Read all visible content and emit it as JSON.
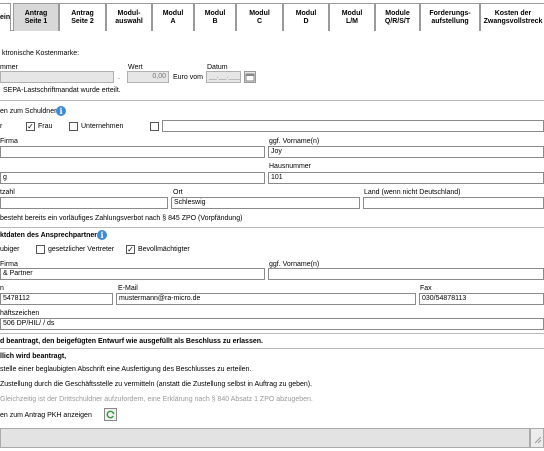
{
  "tabs": [
    {
      "label": "ein"
    },
    {
      "label": "Antrag\nSeite 1"
    },
    {
      "label": "Antrag\nSeite 2"
    },
    {
      "label": "Modul-\nauswahl"
    },
    {
      "label": "Modul\nA"
    },
    {
      "label": "Modul\nB"
    },
    {
      "label": "Modul\nC"
    },
    {
      "label": "Modul\nD"
    },
    {
      "label": "Modul\nL/M"
    },
    {
      "label": "Module\nQ/R/S/T"
    },
    {
      "label": "Forderungs-\naufstellung"
    },
    {
      "label": "Kosten der\nZwangsvollstreck"
    }
  ],
  "kostenmarke": {
    "label": "ktronische Kostenmarke:",
    "nummer_label": "mmer",
    "wert_label": "Wert",
    "datum_label": "Datum",
    "wert_value": "0,00",
    "dot": ".",
    "euro_vom": "Euro vom",
    "datum_placeholder": "__.__.____",
    "sepa": "SEPA-Lastschriftmandat wurde erteilt."
  },
  "schuldner": {
    "header": "en zum Schuldner:",
    "herr": "r",
    "frau": "Frau",
    "unternehmen": "Unternehmen",
    "firma_label": "Firma",
    "vorname_label": "ggf. Vorname(n)",
    "vorname_value": "Joy",
    "strasse_value": "g",
    "hausnummer_label": "Hausnummer",
    "hausnummer_value": "101",
    "plz_label": "tzahl",
    "ort_label": "Ort",
    "ort_value": "Schleswig",
    "land_label": "Land (wenn nicht Deutschland)",
    "vorpfaendung": "besteht bereits ein vorläufiges Zahlungsverbot nach § 845 ZPO (Vorpfändung)"
  },
  "ansprechpartner": {
    "header": "ktdaten des Ansprechpartners:",
    "glaeubiger": "ubiger",
    "vertreter": "gesetzlicher Vertreter",
    "bevollmaechtigter": "Bevollmächtigter",
    "firma_label": "Firma",
    "vorname_label": "ggf. Vorname(n)",
    "firma_value": "& Partner",
    "telefon_label": "n",
    "email_label": "E-Mail",
    "fax_label": "Fax",
    "telefon_value": "5478112",
    "email_value": "mustermann@ra-micro.de",
    "fax_value": "030/54878113",
    "zeichen_label": "häftszeichen",
    "zeichen_value": "506 DP/HIL/ / ds"
  },
  "beantragt": {
    "line1": "d beantragt, den beigefügten Entwurf wie ausgefüllt als Beschluss zu erlassen.",
    "line2": "llich wird beantragt,",
    "opt1": "stelle einer beglaubigten Abschrift eine Ausfertigung des Beschlusses zu erteilen.",
    "opt2": "Zustellung durch die Geschäftsstelle zu vermitteln (anstatt die Zustellung selbst in Auftrag zu geben).",
    "opt3": "Gleichzeitig ist der Drittschuldner aufzufordern, eine Erklärung nach § 840 Absatz 1 ZPO abzugeben.",
    "pkh": "en zum Antrag PKH anzeigen"
  },
  "colors": {
    "info": "#3c8ad8",
    "refresh": "#2e9a3a"
  },
  "icons": {
    "info": "info-icon",
    "refresh": "refresh-icon"
  }
}
